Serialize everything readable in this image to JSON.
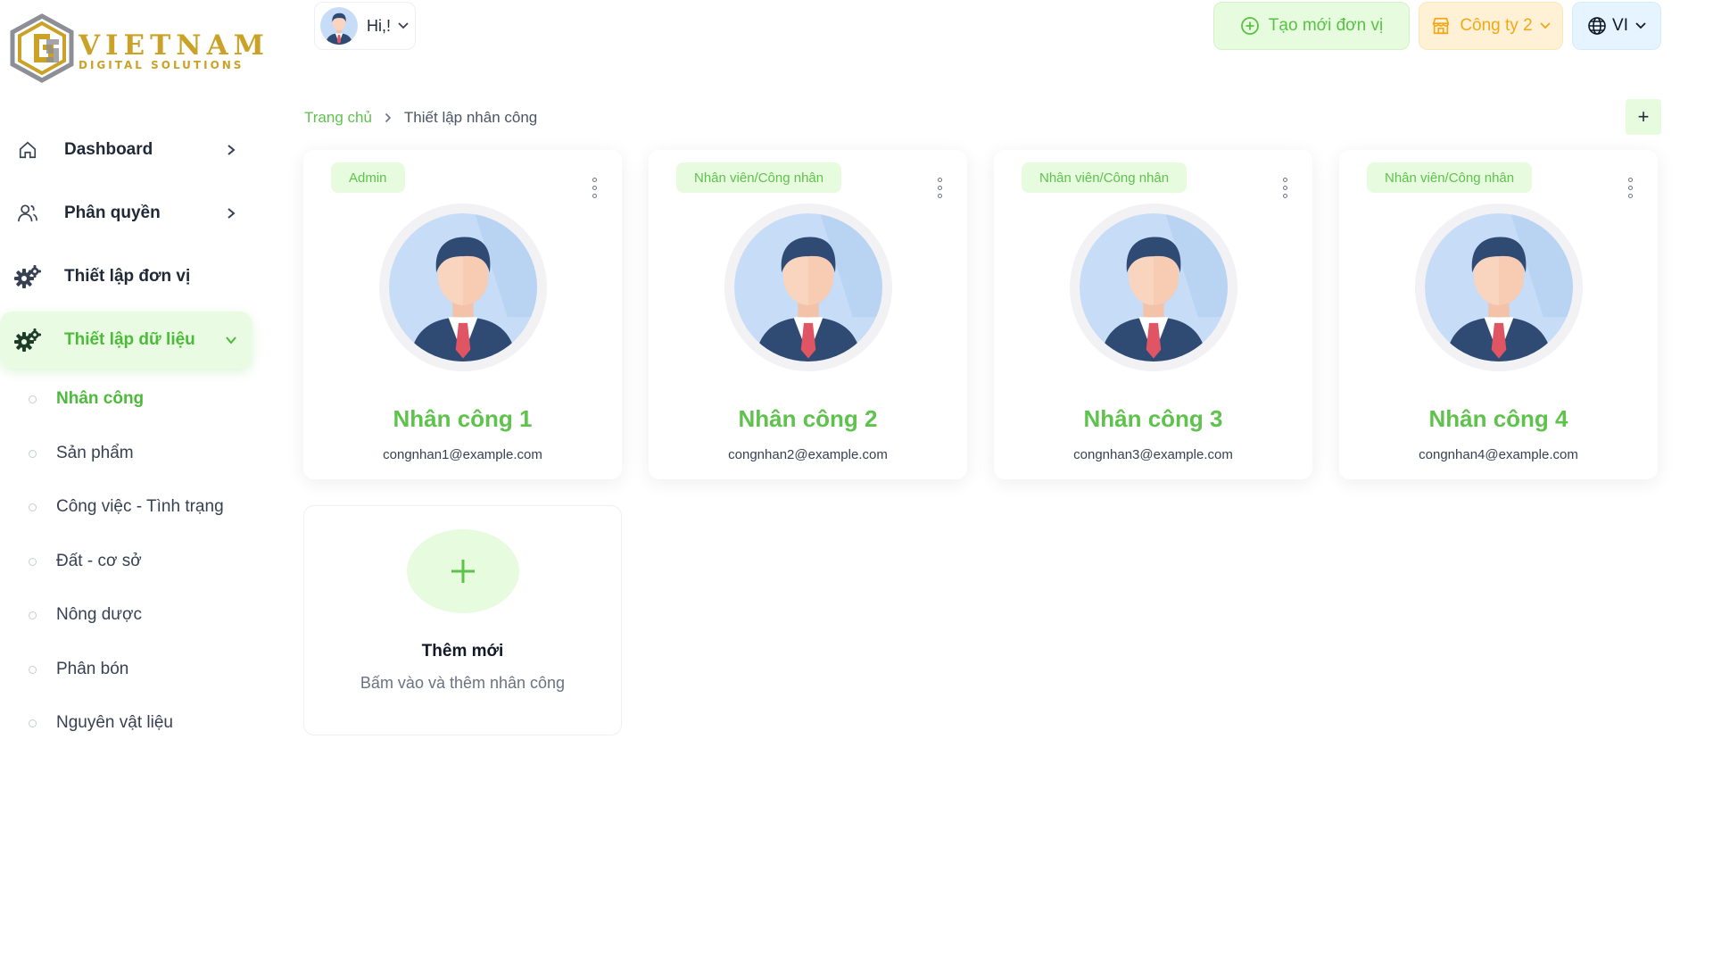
{
  "brand": {
    "name": "VIETNAM",
    "tagline": "DIGITAL SOLUTIONS",
    "color": "#c9a227"
  },
  "colors": {
    "accent": "#5fc24d",
    "accent_bg": "#e7fbdf",
    "company_accent": "#f2a816",
    "lang_bg": "#e6f4ff"
  },
  "header": {
    "greeting": "Hi,!",
    "create_unit_label": "Tạo mới đơn vị",
    "company_label": "Công ty 2",
    "language_label": "VI"
  },
  "sidebar": {
    "items": [
      {
        "label": "Dashboard",
        "icon": "home-icon",
        "chevron": "right"
      },
      {
        "label": "Phân quyền",
        "icon": "users-icon",
        "chevron": "right"
      },
      {
        "label": "Thiết lập đơn vị",
        "icon": "gears-icon"
      },
      {
        "label": "Thiết lập dữ liệu",
        "icon": "gears-icon",
        "chevron": "down",
        "active": true
      }
    ],
    "subitems": [
      {
        "label": "Nhân công",
        "active": true
      },
      {
        "label": "Sản phẩm"
      },
      {
        "label": "Công việc - Tình trạng"
      },
      {
        "label": "Đất - cơ sở"
      },
      {
        "label": "Nông dược"
      },
      {
        "label": "Phân bón"
      },
      {
        "label": "Nguyên vật liệu"
      }
    ]
  },
  "breadcrumb": {
    "home": "Trang chủ",
    "current": "Thiết lập nhân công"
  },
  "add_button_label": "+",
  "workers": [
    {
      "role": "Admin",
      "name": "Nhân công 1",
      "email": "congnhan1@example.com"
    },
    {
      "role": "Nhân viên/Công nhân",
      "name": "Nhân công 2",
      "email": "congnhan2@example.com"
    },
    {
      "role": "Nhân viên/Công nhân",
      "name": "Nhân công 3",
      "email": "congnhan3@example.com"
    },
    {
      "role": "Nhân viên/Công nhân",
      "name": "Nhân công 4",
      "email": "congnhan4@example.com"
    }
  ],
  "add_card": {
    "title": "Thêm mới",
    "subtitle": "Bấm vào và thêm nhân công"
  }
}
